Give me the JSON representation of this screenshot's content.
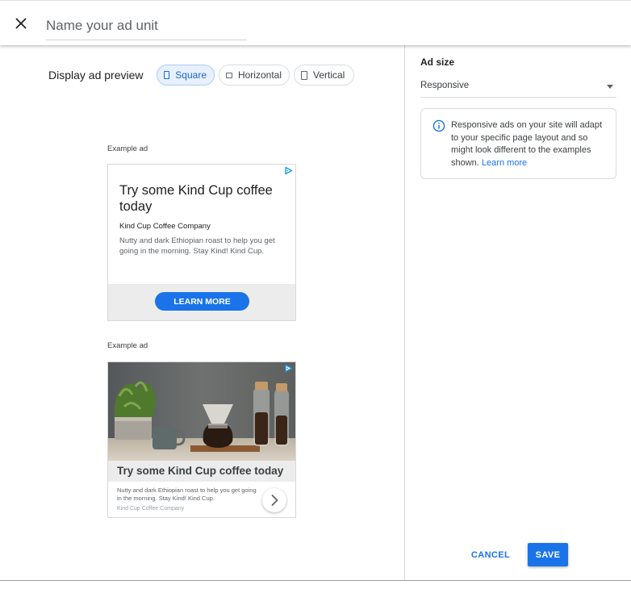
{
  "header": {
    "ad_unit_name_placeholder": "Name your ad unit",
    "close_icon": "close-icon"
  },
  "preview": {
    "label": "Display ad preview",
    "formats": [
      {
        "label": "Square",
        "icon": "square-icon",
        "selected": true
      },
      {
        "label": "Horizontal",
        "icon": "horizontal-rectangle-icon",
        "selected": false
      },
      {
        "label": "Vertical",
        "icon": "vertical-rectangle-icon",
        "selected": false
      }
    ],
    "ads": [
      {
        "label": "Example ad",
        "title": "Try some Kind Cup coffee today",
        "company": "Kind Cup Coffee Company",
        "body": "Nutty and dark Ethiopian roast to help you get going in the morning. Stay Kind! Kind Cup.",
        "cta": "LEARN MORE"
      },
      {
        "label": "Example ad",
        "title": "Try some Kind Cup coffee today",
        "body": "Nutty and dark Ethiopian roast to help you get going in the morning. Stay Kind! Kind Cup.",
        "company": "Kind Cup Coffee Company",
        "arrow_icon": "chevron-right-icon"
      }
    ]
  },
  "ad_size": {
    "label": "Ad size",
    "selected": "Responsive",
    "info_icon": "info-icon",
    "info_text": "Responsive ads on your site will adapt to your specific page layout and so might look different to the examples shown.",
    "info_link": "Learn more"
  },
  "actions": {
    "cancel": "CANCEL",
    "save": "SAVE"
  },
  "colors": {
    "accent": "#1a73e8",
    "chip_selected_bg": "#e8f0fe",
    "ad_footer_bg": "#ececec"
  }
}
